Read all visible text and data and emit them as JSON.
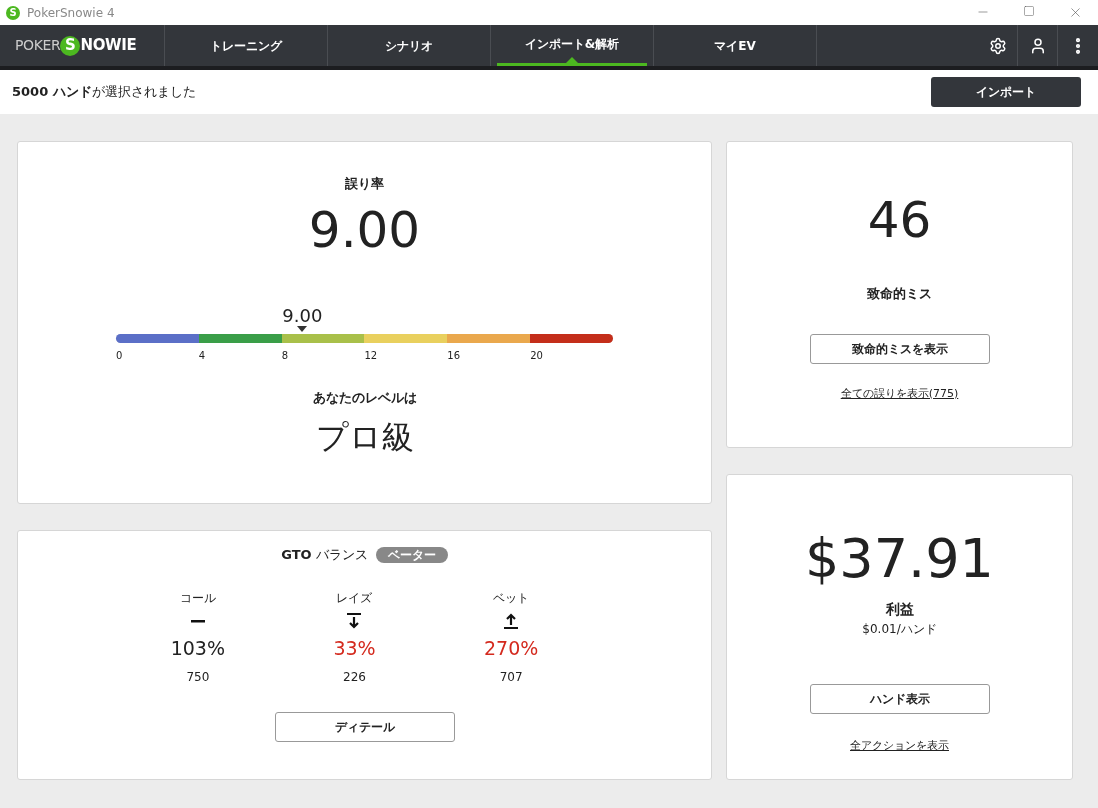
{
  "window": {
    "title": "PokerSnowie 4",
    "icon_letter": "S"
  },
  "nav": {
    "logo": {
      "prefix": "POKER",
      "badge": "S",
      "suffix": "NOWIE"
    },
    "tabs": [
      {
        "label": "トレーニング",
        "selected": false
      },
      {
        "label": "シナリオ",
        "selected": false
      },
      {
        "label": "インポート&解析",
        "selected": true
      },
      {
        "label": "マイEV",
        "selected": false
      }
    ]
  },
  "selection": "**5000 ハンド**が選択されました",
  "import_button": "インポート",
  "error_card": {
    "label": "誤り率",
    "value": "9.00",
    "scale": {
      "marker_label": "9.00",
      "level": 0.375,
      "segments": [
        {
          "color": "#5b6fc7"
        },
        {
          "color": "#3a9e48"
        },
        {
          "color": "#a9c04a"
        },
        {
          "color": "#e9d05e"
        },
        {
          "color": "#eaa84d"
        },
        {
          "color": "#c42e1a"
        }
      ],
      "ticks": [
        "0",
        "4",
        "8",
        "12",
        "16",
        "20"
      ]
    },
    "level_label": "あなたのレベルは",
    "level_value": "プロ級"
  },
  "gto_card": {
    "title": "**GTO** バランス",
    "badge": "ベーター",
    "columns": [
      {
        "label": "コール",
        "kind": "dash",
        "percent": "103%",
        "alert": false,
        "count": "750"
      },
      {
        "label": "レイズ",
        "kind": "down",
        "percent": "33%",
        "alert": true,
        "count": "226"
      },
      {
        "label": "ベット",
        "kind": "up",
        "percent": "270%",
        "alert": true,
        "count": "707"
      }
    ],
    "button": "ディテール"
  },
  "blunder_card": {
    "value": "46",
    "label": "致命的ミス",
    "button": "致命的ミスを表示",
    "link": "全ての誤りを表示(775)"
  },
  "profit_card": {
    "value": "$37.91",
    "label": "利益",
    "sub": "$0.01/ハンド",
    "button": "ハンド表示",
    "link": "全アクションを表示"
  }
}
